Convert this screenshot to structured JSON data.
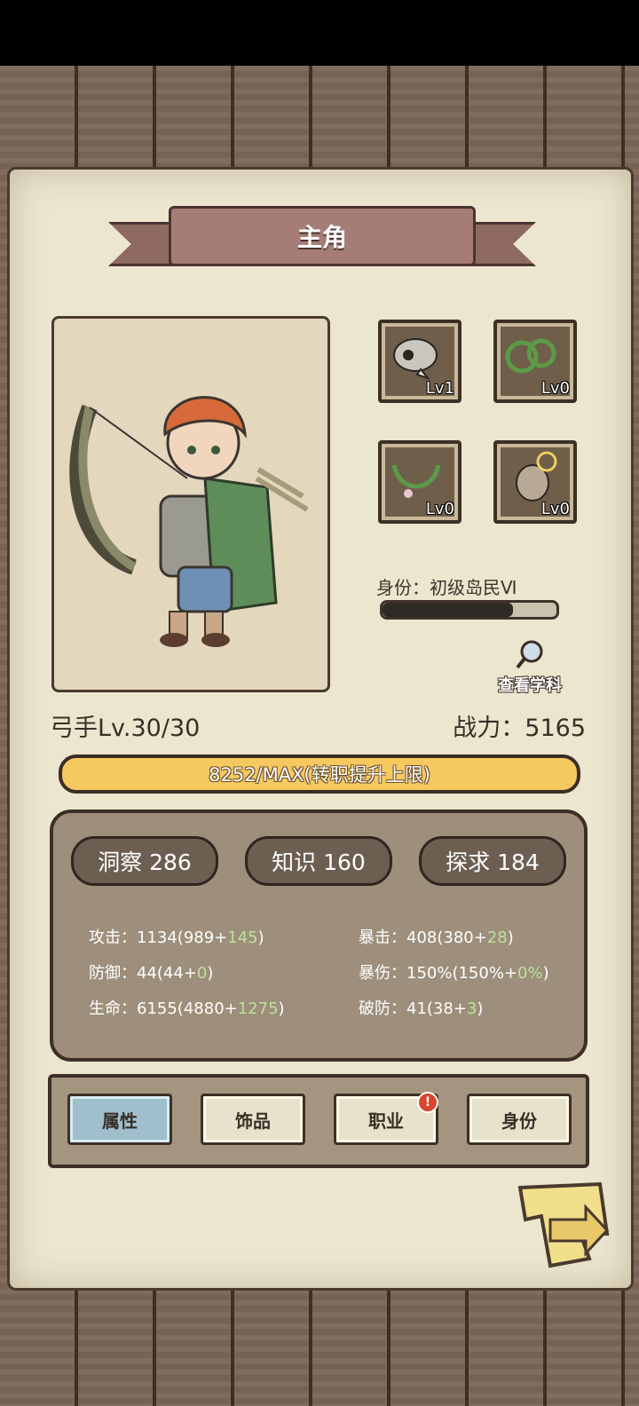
{
  "header": {
    "title": "主角"
  },
  "equipment": [
    {
      "icon": "skull-icon",
      "level": "Lv1"
    },
    {
      "icon": "vine-ring-icon",
      "level": "Lv0"
    },
    {
      "icon": "vine-necklace-icon",
      "level": "Lv0"
    },
    {
      "icon": "stone-idol-icon",
      "level": "Lv0"
    }
  ],
  "identity": {
    "label": "身份：初级岛民Ⅵ",
    "progress": 0.75
  },
  "view_subject": {
    "label": "查看学科"
  },
  "character": {
    "class_level": "弓手Lv.30/30",
    "power": "战力：5165"
  },
  "exp": {
    "text": "8252/MAX(转职提升上限)"
  },
  "attributes": [
    {
      "label": "洞察 286"
    },
    {
      "label": "知识 160"
    },
    {
      "label": "探求 184"
    }
  ],
  "stats_left": [
    {
      "name": "攻击：",
      "base": "1134(989+",
      "bonus": "145",
      "end": ")"
    },
    {
      "name": "防御：",
      "base": "44(44+",
      "bonus": "0",
      "end": ")"
    },
    {
      "name": "生命：",
      "base": "6155(4880+",
      "bonus": "1275",
      "end": ")"
    }
  ],
  "stats_right": [
    {
      "name": "暴击：",
      "base": "408(380+",
      "bonus": "28",
      "end": ")"
    },
    {
      "name": "暴伤：",
      "base": "150%(150%+",
      "bonus": "0%",
      "end": ")"
    },
    {
      "name": "破防：",
      "base": "41(38+",
      "bonus": "3",
      "end": ")"
    }
  ],
  "tabs": [
    {
      "label": "属性",
      "active": true
    },
    {
      "label": "饰品",
      "active": false
    },
    {
      "label": "职业",
      "active": false,
      "badge": "!"
    },
    {
      "label": "身份",
      "active": false
    }
  ],
  "colors": {
    "exp_bar": "#f6c860",
    "panel": "#9d8f7b",
    "active_tab": "#9fbfcd",
    "bonus_green": "#bde19b"
  }
}
